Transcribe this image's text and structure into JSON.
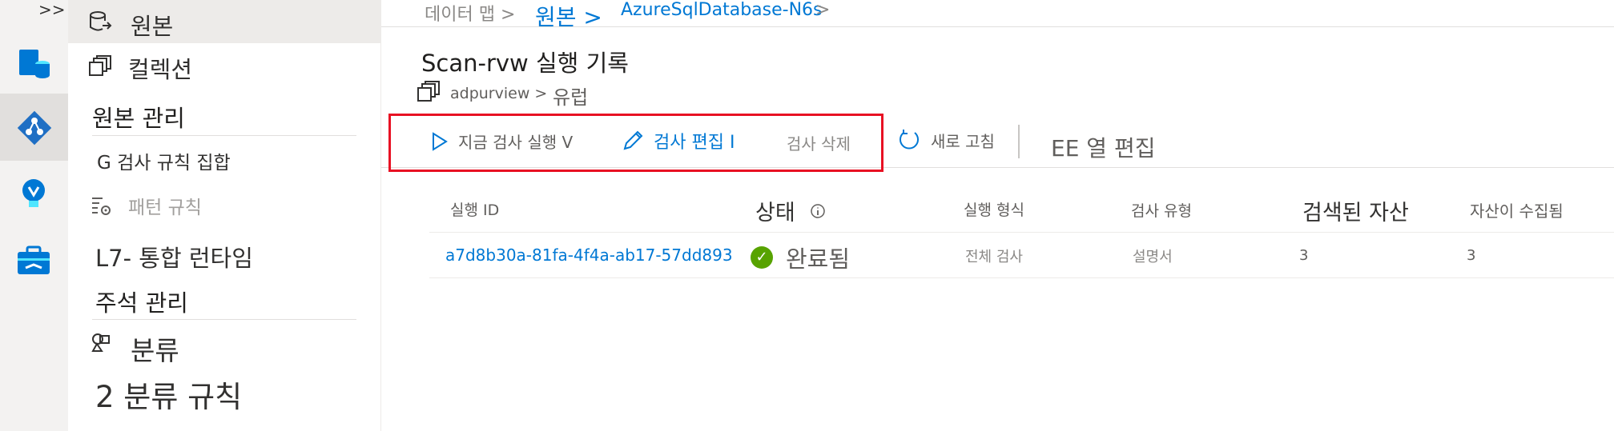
{
  "rail": {
    "expand": ">>",
    "items": [
      {
        "name": "data-catalog-icon"
      },
      {
        "name": "data-map-icon",
        "selected": true
      },
      {
        "name": "insights-icon"
      },
      {
        "name": "management-icon"
      }
    ]
  },
  "nav": {
    "sources": "원본",
    "collections": "컬렉션",
    "source_mgmt_header": "원본 관리",
    "scan_rule_sets": "G 검사 규칙 집합",
    "pattern_rules": "패턴 규칙",
    "integration_runtime": "L7- 통합 런타임",
    "annotation_mgmt": "주석 관리",
    "classifications": "분류",
    "classification_rules": "2 분류 규칙"
  },
  "breadcrumb": {
    "data_map": "데이터 맵 >",
    "sources": "원본 >",
    "asset": "AzureSqlDatabase-N6s",
    "chev": ">"
  },
  "page": {
    "title": "Scan-rvw 실행 기록",
    "path_root": "adpurview >",
    "path_leaf": "유럽"
  },
  "toolbar": {
    "run_now": "지금 검사 실행 V",
    "edit_scan": "검사 편집 I",
    "delete_scan": "검사 삭제",
    "refresh": "새로 고침",
    "edit_columns": "EE 열 편집"
  },
  "table": {
    "headers": {
      "run_id": "실행 ID",
      "status": "상태",
      "run_type": "실행 형식",
      "scan_type": "검사 유형",
      "discovered": "검색된 자산",
      "ingested": "자산이 수집됨"
    },
    "rows": [
      {
        "run_id": "a7d8b30a-81fa-4f4a-ab17-57dd893",
        "status": "완료됨",
        "run_type": "전체 검사",
        "scan_type": "설명서",
        "discovered": "3",
        "ingested": "3"
      }
    ]
  },
  "colors": {
    "accent": "#0078d4",
    "success": "#57a300",
    "highlight": "#e81123"
  }
}
